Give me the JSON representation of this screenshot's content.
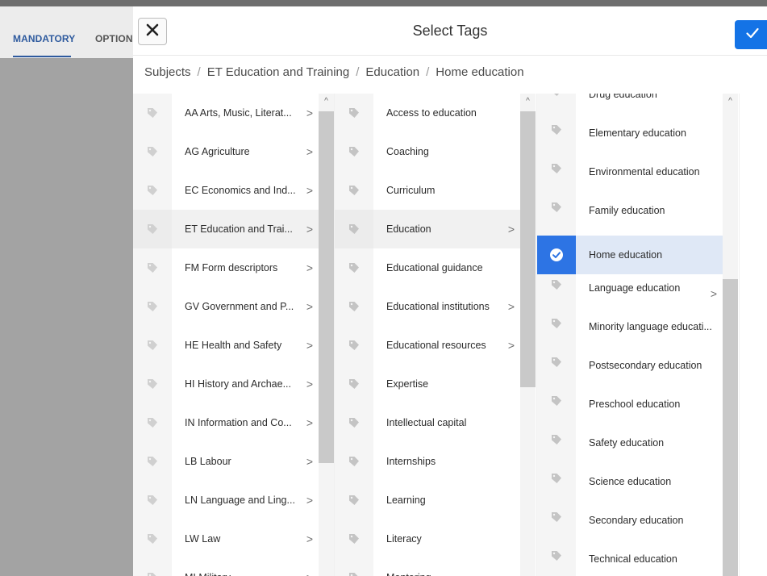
{
  "background": {
    "tabs": [
      {
        "label": "MANDATORY",
        "active": true
      },
      {
        "label": "OPTIONAL",
        "active": false
      }
    ]
  },
  "modal": {
    "title": "Select Tags",
    "close_icon": "close-icon",
    "confirm_icon": "checkmark-icon",
    "accent_color": "#1473e6"
  },
  "breadcrumb": [
    "Subjects",
    "ET Education and Training",
    "Education",
    "Home education"
  ],
  "columns": [
    {
      "items": [
        {
          "label": "AA Arts, Music, Literat...",
          "has_children": true
        },
        {
          "label": "AG Agriculture",
          "has_children": true
        },
        {
          "label": "EC Economics and Ind...",
          "has_children": true
        },
        {
          "label": "ET Education and Trai...",
          "has_children": true,
          "selected": true
        },
        {
          "label": "FM Form descriptors",
          "has_children": true
        },
        {
          "label": "GV Government and P...",
          "has_children": true
        },
        {
          "label": "HE Health and Safety",
          "has_children": true
        },
        {
          "label": "HI History and Archae...",
          "has_children": true
        },
        {
          "label": "IN Information and Co...",
          "has_children": true
        },
        {
          "label": "LB Labour",
          "has_children": true
        },
        {
          "label": "LN Language and Ling...",
          "has_children": true
        },
        {
          "label": "LW Law",
          "has_children": true
        },
        {
          "label": "MI Military",
          "has_children": true
        }
      ]
    },
    {
      "items": [
        {
          "label": "Access to education",
          "has_children": false
        },
        {
          "label": "Coaching",
          "has_children": false
        },
        {
          "label": "Curriculum",
          "has_children": false
        },
        {
          "label": "Education",
          "has_children": true,
          "selected": true
        },
        {
          "label": "Educational guidance",
          "has_children": false
        },
        {
          "label": "Educational institutions",
          "has_children": true
        },
        {
          "label": "Educational resources",
          "has_children": true
        },
        {
          "label": "Expertise",
          "has_children": false
        },
        {
          "label": "Intellectual capital",
          "has_children": false
        },
        {
          "label": "Internships",
          "has_children": false
        },
        {
          "label": "Learning",
          "has_children": false
        },
        {
          "label": "Literacy",
          "has_children": false
        },
        {
          "label": "Mentoring",
          "has_children": false
        }
      ]
    },
    {
      "items": [
        {
          "label": "Drug education",
          "has_children": false
        },
        {
          "label": "Elementary education",
          "has_children": false
        },
        {
          "label": "Environmental education",
          "has_children": false
        },
        {
          "label": "Family education",
          "has_children": false
        },
        {
          "label": "Home education",
          "has_children": false,
          "checked": true
        },
        {
          "label": "Language education",
          "has_children": true
        },
        {
          "label": "Minority language educati...",
          "has_children": false
        },
        {
          "label": "Postsecondary education",
          "has_children": false
        },
        {
          "label": "Preschool education",
          "has_children": false
        },
        {
          "label": "Safety education",
          "has_children": false
        },
        {
          "label": "Science education",
          "has_children": false
        },
        {
          "label": "Secondary education",
          "has_children": false
        },
        {
          "label": "Technical education",
          "has_children": false
        }
      ]
    }
  ]
}
